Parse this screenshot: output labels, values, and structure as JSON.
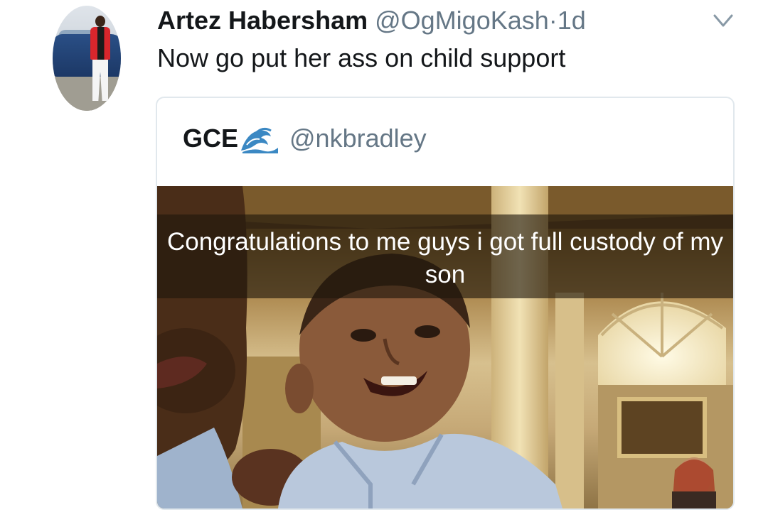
{
  "tweet": {
    "author_name": "Artez Habersham",
    "author_handle": "@OgMigoKash",
    "separator": "·",
    "time": "1d",
    "text": "Now go put her ass on child support",
    "menu_icon": "chevron-down-icon",
    "avatar_icon": "avatar"
  },
  "quoted_tweet": {
    "author_name": "GCE",
    "author_emoji": "water-wave-icon",
    "author_handle": "@nkbradley",
    "media": {
      "caption": "Congratulations to me guys i got full custody of my son"
    }
  },
  "colors": {
    "primary_text": "#14171a",
    "secondary_text": "#657786",
    "border": "#e1e8ed",
    "emoji_blue": "#3b88c3"
  }
}
